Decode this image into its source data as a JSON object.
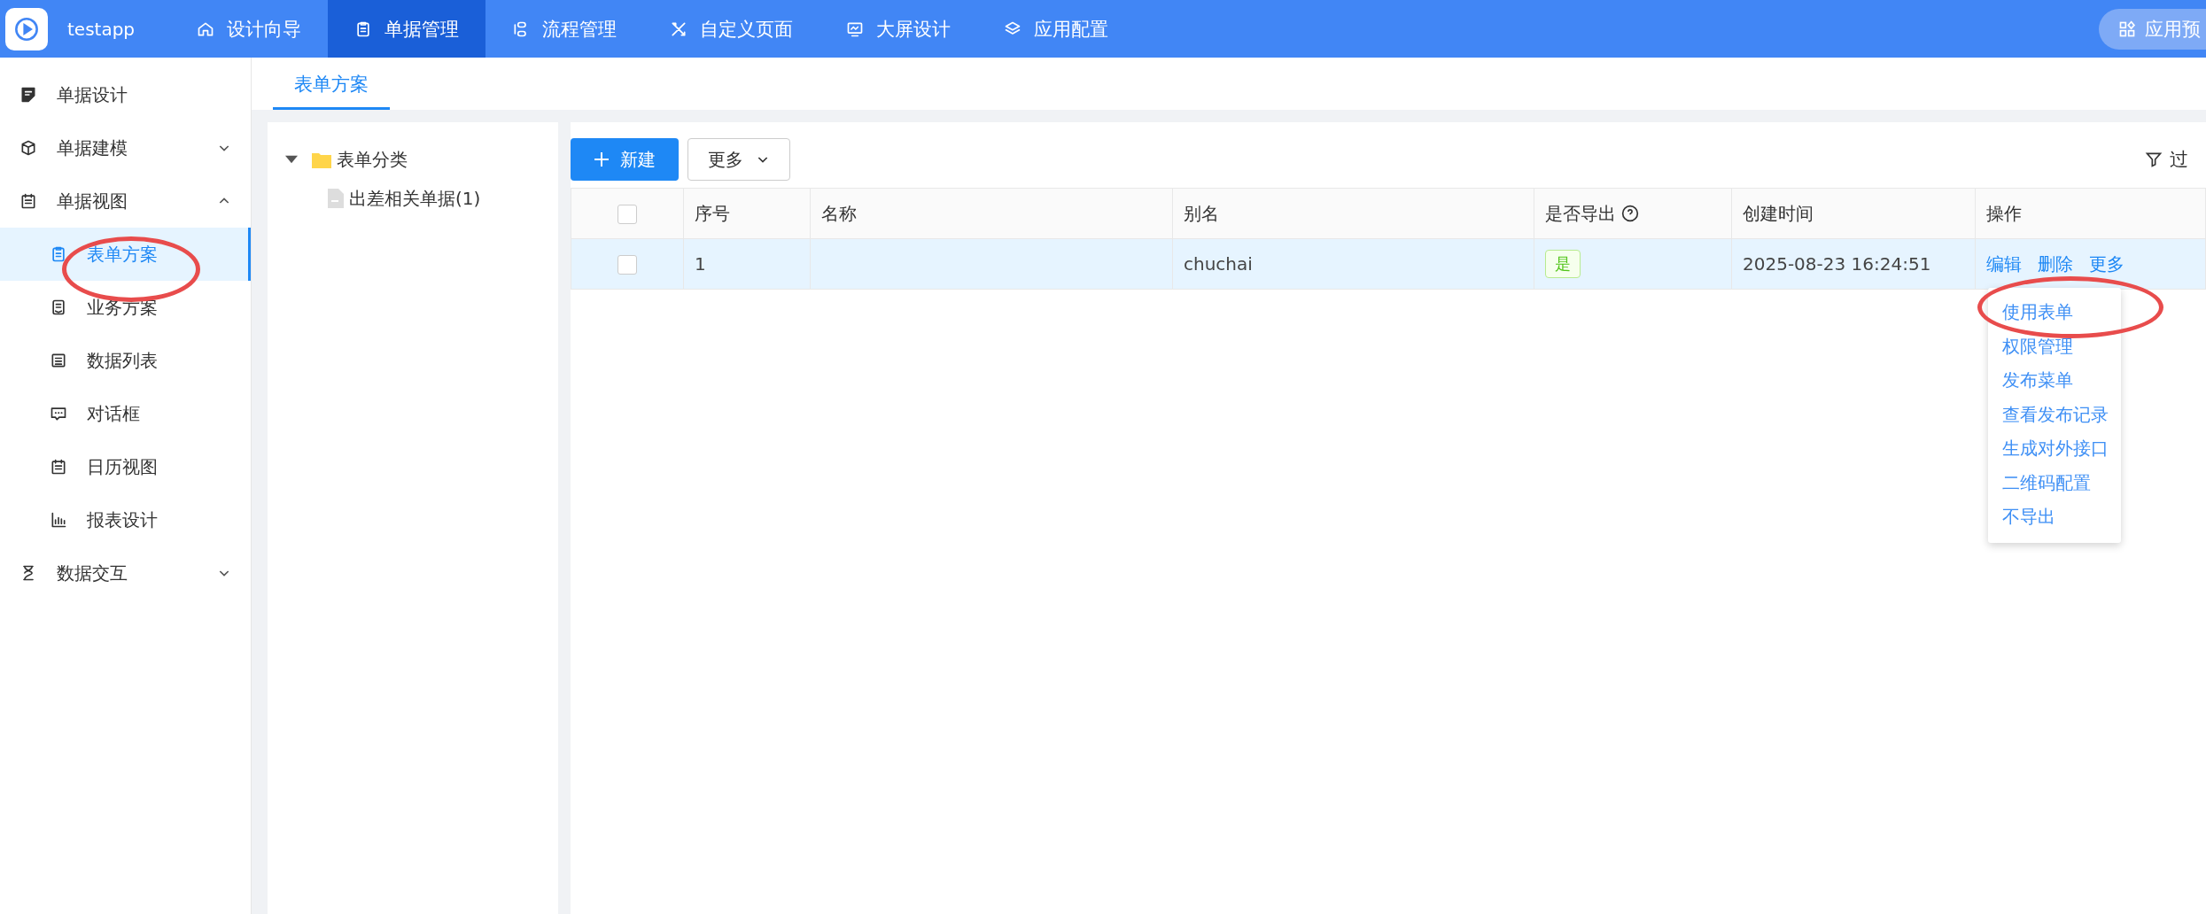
{
  "header": {
    "app_name": "testapp",
    "nav": [
      {
        "label": "设计向导",
        "selected": false
      },
      {
        "label": "单据管理",
        "selected": true
      },
      {
        "label": "流程管理",
        "selected": false
      },
      {
        "label": "自定义页面",
        "selected": false
      },
      {
        "label": "大屏设计",
        "selected": false
      },
      {
        "label": "应用配置",
        "selected": false
      }
    ],
    "preview_button": "应用预"
  },
  "sidebar": {
    "items": [
      {
        "label": "单据设计",
        "selected": false
      },
      {
        "label": "单据建模",
        "selected": false,
        "expanded": false
      },
      {
        "label": "单据视图",
        "selected": false,
        "expanded": true,
        "children": [
          {
            "label": "表单方案",
            "selected": true
          },
          {
            "label": "业务方案",
            "selected": false
          },
          {
            "label": "数据列表",
            "selected": false
          },
          {
            "label": "对话框",
            "selected": false
          },
          {
            "label": "日历视图",
            "selected": false
          },
          {
            "label": "报表设计",
            "selected": false
          }
        ]
      },
      {
        "label": "数据交互",
        "selected": false,
        "expanded": false
      }
    ]
  },
  "tabs": [
    {
      "label": "表单方案",
      "selected": true
    }
  ],
  "tree": [
    {
      "label": "表单分类",
      "expanded": true,
      "children": [
        {
          "label": "出差相关单据(1)"
        }
      ]
    }
  ],
  "toolbar": {
    "new_button": "新建",
    "more_button": "更多",
    "filter_button": "过"
  },
  "table": {
    "select_all_checked": false,
    "columns": [
      "序号",
      "名称",
      "别名",
      "是否导出",
      "创建时间",
      "操作"
    ],
    "rows": [
      {
        "checked": false,
        "index": "1",
        "alias": "chuchai",
        "export": "是",
        "created": "2025-08-23 16:24:51",
        "actions": [
          "编辑",
          "删除",
          "更多"
        ]
      }
    ]
  },
  "dropdown": {
    "items": [
      "使用表单",
      "权限管理",
      "发布菜单",
      "查看发布记录",
      "生成对外接口",
      "二维码配置",
      "不导出"
    ]
  }
}
